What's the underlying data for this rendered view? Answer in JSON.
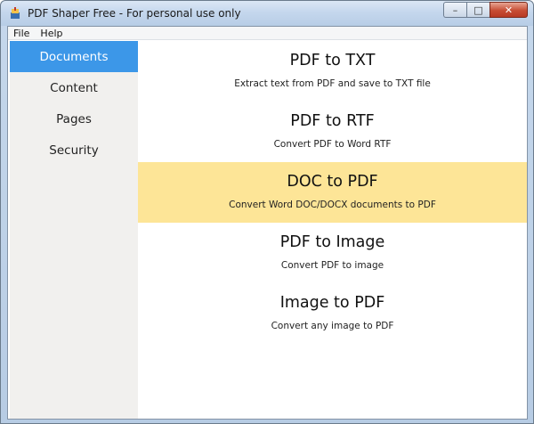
{
  "window": {
    "title": "PDF Shaper Free - For personal use only",
    "controls": {
      "minimize": "–",
      "maximize": "□",
      "close": "✕"
    }
  },
  "menu": {
    "items": [
      "File",
      "Help"
    ]
  },
  "sidebar": {
    "items": [
      {
        "label": "Documents",
        "active": true
      },
      {
        "label": "Content",
        "active": false
      },
      {
        "label": "Pages",
        "active": false
      },
      {
        "label": "Security",
        "active": false
      }
    ]
  },
  "tools": [
    {
      "title": "PDF to TXT",
      "description": "Extract text from PDF and save to TXT file",
      "highlighted": false
    },
    {
      "title": "PDF to RTF",
      "description": "Convert PDF to Word RTF",
      "highlighted": false
    },
    {
      "title": "DOC to PDF",
      "description": "Convert Word DOC/DOCX documents to PDF",
      "highlighted": true
    },
    {
      "title": "PDF to Image",
      "description": "Convert PDF to image",
      "highlighted": false
    },
    {
      "title": "Image to PDF",
      "description": "Convert any image to PDF",
      "highlighted": false
    }
  ],
  "colors": {
    "active_tab": "#3c97e8",
    "highlight": "#fde597",
    "sidebar_bg": "#f1f0ee"
  }
}
